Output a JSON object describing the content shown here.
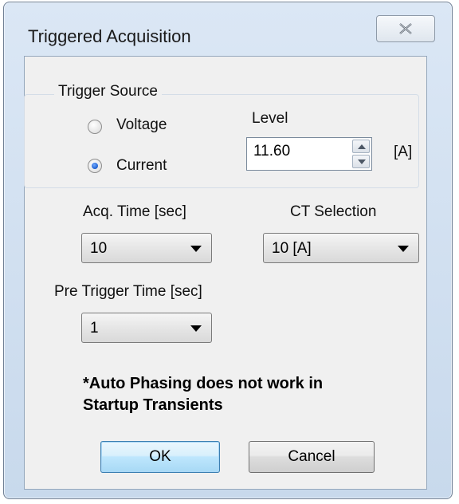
{
  "window": {
    "title": "Triggered Acquisition"
  },
  "trigger_source": {
    "legend": "Trigger Source",
    "options": [
      {
        "label": "Voltage",
        "selected": false
      },
      {
        "label": "Current",
        "selected": true
      }
    ],
    "level_label": "Level",
    "level_value": "11.60",
    "level_unit": "[A]"
  },
  "acq_time": {
    "label": "Acq. Time [sec]",
    "selected": "10"
  },
  "ct_selection": {
    "label": "CT Selection",
    "selected": "10 [A]"
  },
  "pre_trigger": {
    "label": "Pre Trigger Time [sec]",
    "selected": "1"
  },
  "note": {
    "line1": "*Auto Phasing does not work in",
    "line2": "Startup Transients"
  },
  "buttons": {
    "ok": "OK",
    "cancel": "Cancel"
  }
}
